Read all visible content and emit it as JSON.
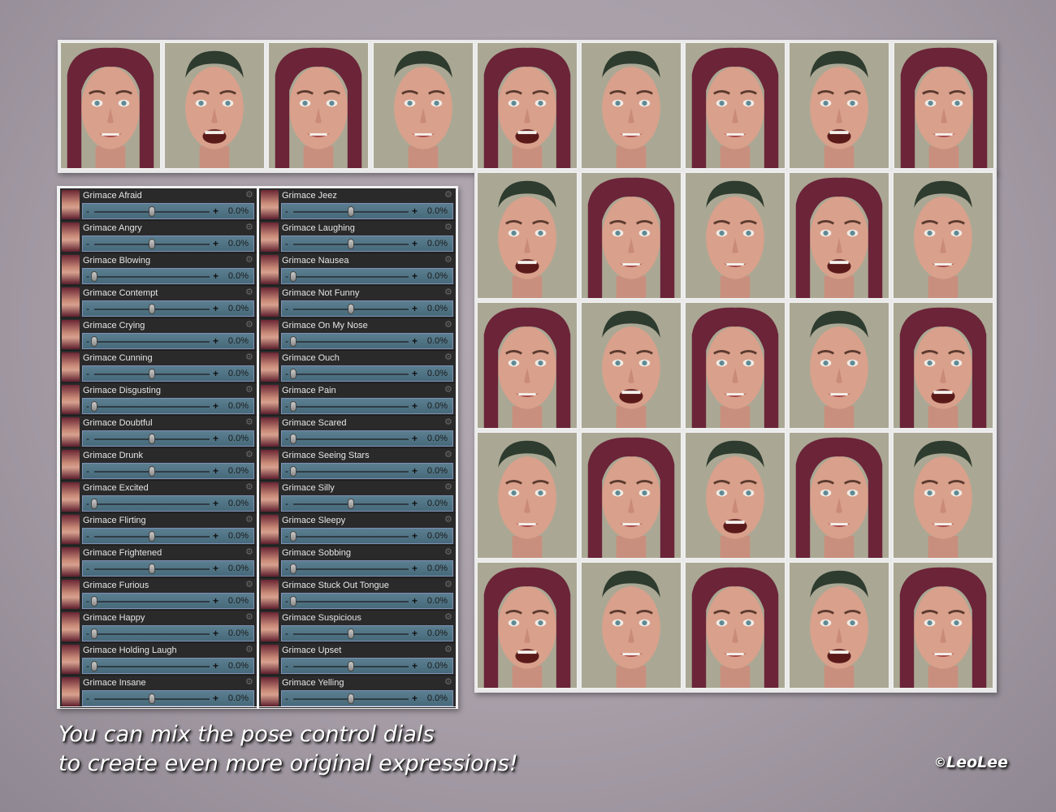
{
  "dials": {
    "value_text": "0.0%",
    "left_column": [
      {
        "label": "Grimace  Afraid",
        "level": 0.5
      },
      {
        "label": "Grimace Angry",
        "level": 0.5
      },
      {
        "label": "Grimace Blowing",
        "level": 0.0
      },
      {
        "label": "Grimace Contempt",
        "level": 0.5
      },
      {
        "label": "Grimace Crying",
        "level": 0.0
      },
      {
        "label": "Grimace Cunning",
        "level": 0.5
      },
      {
        "label": "Grimace Disgusting",
        "level": 0.0
      },
      {
        "label": "Grimace Doubtful",
        "level": 0.5
      },
      {
        "label": "Grimace Drunk",
        "level": 0.5
      },
      {
        "label": "Grimace Excited",
        "level": 0.0
      },
      {
        "label": "Grimace Flirting",
        "level": 0.5
      },
      {
        "label": "Grimace Frightened",
        "level": 0.5
      },
      {
        "label": "Grimace Furious",
        "level": 0.0
      },
      {
        "label": "Grimace Happy",
        "level": 0.0
      },
      {
        "label": "Grimace Holding Laugh",
        "level": 0.0
      },
      {
        "label": "Grimace Insane",
        "level": 0.5
      }
    ],
    "right_column": [
      {
        "label": "Grimace Jeez",
        "level": 0.5
      },
      {
        "label": "Grimace Laughing",
        "level": 0.5
      },
      {
        "label": "Grimace Nausea",
        "level": 0.0
      },
      {
        "label": "Grimace Not Funny",
        "level": 0.5
      },
      {
        "label": "Grimace On My Nose",
        "level": 0.0
      },
      {
        "label": "Grimace Ouch",
        "level": 0.0
      },
      {
        "label": "Grimace Pain",
        "level": 0.0
      },
      {
        "label": "Grimace Scared",
        "level": 0.0
      },
      {
        "label": "Grimace Seeing Stars",
        "level": 0.0
      },
      {
        "label": "Grimace Silly",
        "level": 0.5
      },
      {
        "label": "Grimace Sleepy",
        "level": 0.0
      },
      {
        "label": "Grimace Sobbing",
        "level": 0.0
      },
      {
        "label": "Grimace Stuck Out Tongue",
        "level": 0.0
      },
      {
        "label": "Grimace Suspicious",
        "level": 0.5
      },
      {
        "label": "Grimace Upset",
        "level": 0.5
      },
      {
        "label": "Grimace Yelling",
        "level": 0.5
      }
    ]
  },
  "faces": {
    "top_row": [
      "female",
      "male",
      "female",
      "male",
      "female",
      "male",
      "female",
      "male",
      "female"
    ],
    "grid_rows": [
      [
        "male",
        "female",
        "male",
        "female",
        "male"
      ],
      [
        "female",
        "male",
        "female",
        "male",
        "female"
      ],
      [
        "male",
        "female",
        "male",
        "female",
        "male"
      ],
      [
        "female",
        "male",
        "female",
        "male",
        "female"
      ]
    ]
  },
  "caption": {
    "line1": "You can mix the pose control dials",
    "line2": "to create even more original expressions!"
  },
  "copyright": {
    "symbol": "©",
    "name": "LeoLee"
  },
  "colors": {
    "background": "#a79ea8",
    "dial_track": "#4f7385",
    "dial_panel": "#2a2a2a",
    "female_hair": "#6b2438",
    "male_hair": "#2e3b2f"
  }
}
